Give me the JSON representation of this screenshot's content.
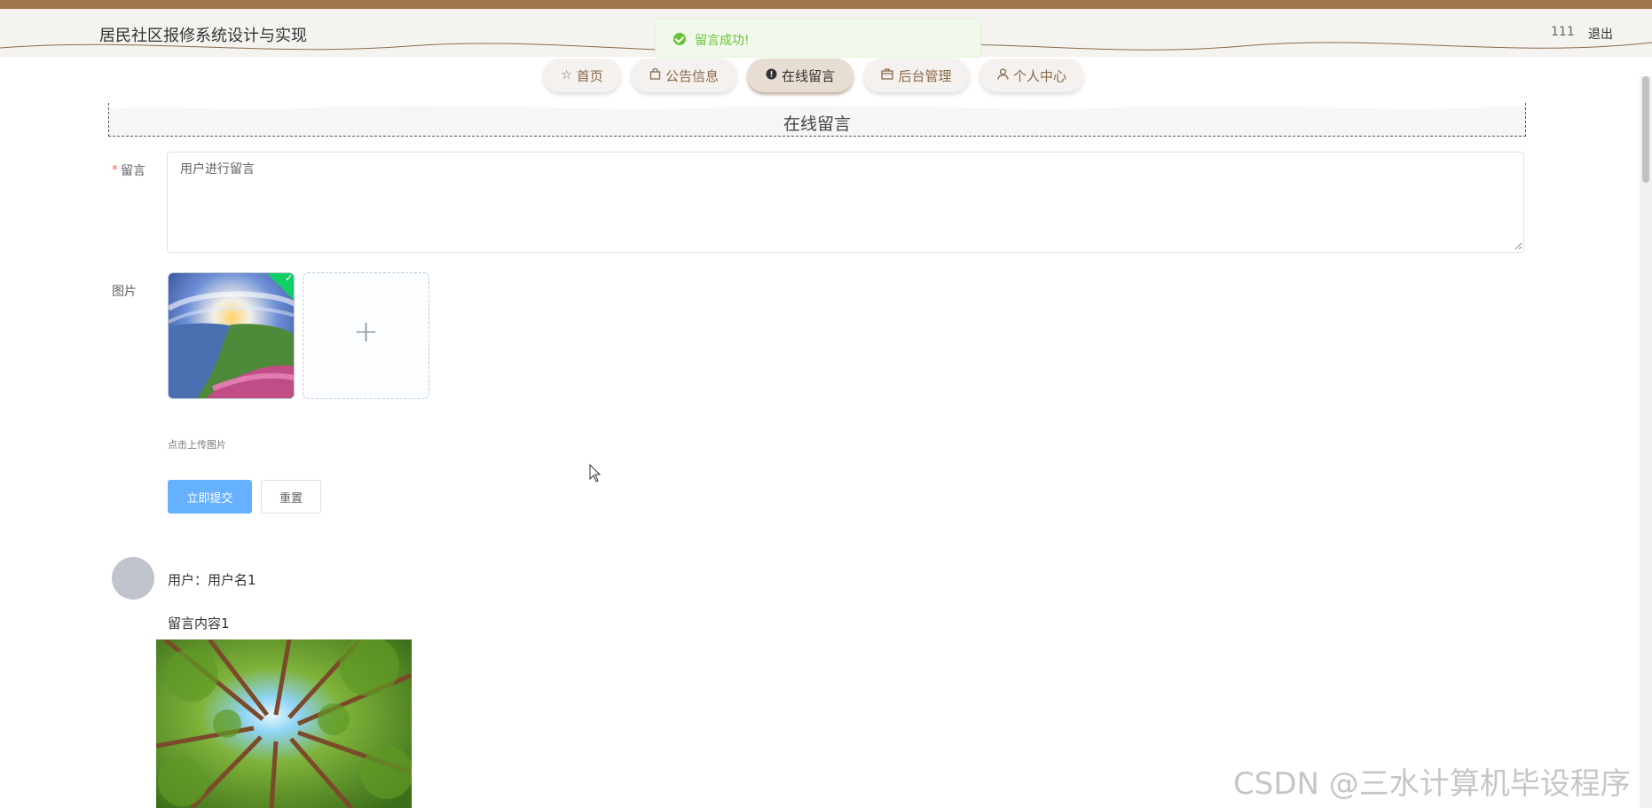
{
  "header": {
    "site_title": "居民社区报修系统设计与实现",
    "user_name": "111",
    "logout_label": "退出"
  },
  "toast": {
    "message": "留言成功!"
  },
  "nav": {
    "items": [
      {
        "label": "首页",
        "icon": "star-icon"
      },
      {
        "label": "公告信息",
        "icon": "bag-icon"
      },
      {
        "label": "在线留言",
        "icon": "alert-circle-icon",
        "active": true
      },
      {
        "label": "后台管理",
        "icon": "box-icon"
      },
      {
        "label": "个人中心",
        "icon": "user-icon"
      }
    ]
  },
  "section": {
    "title": "在线留言"
  },
  "form": {
    "required_mark": "*",
    "message_label": "留言",
    "message_value": "用户进行留言",
    "image_label": "图片",
    "upload_hint": "点击上传图片",
    "submit_label": "立即提交",
    "reset_label": "重置"
  },
  "comments": [
    {
      "user": "用户：用户名1",
      "content": "留言内容1"
    }
  ],
  "watermark": "CSDN @三水计算机毕设程序"
}
